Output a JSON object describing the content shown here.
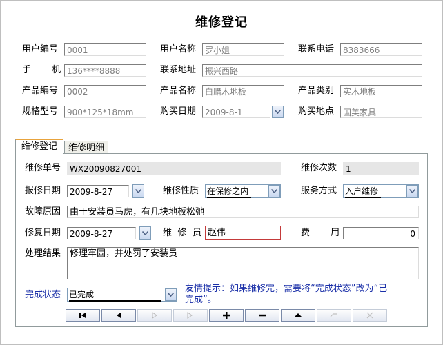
{
  "title": "维修登记",
  "top": {
    "user_id_label": "用户编号",
    "user_id": "0001",
    "user_name_label": "用户名称",
    "user_name": "罗小姐",
    "phone_label": "联系电话",
    "phone": "8383666",
    "mobile_label": "手机",
    "mobile": "136****8888",
    "address_label": "联系地址",
    "address": "振兴西路",
    "product_id_label": "产品编号",
    "product_id": "0002",
    "product_name_label": "产品名称",
    "product_name": "白腊木地板",
    "product_type_label": "产品类别",
    "product_type": "实木地板",
    "spec_label": "规格型号",
    "spec": "900*125*18mm",
    "buy_date_label": "购买日期",
    "buy_date": "2009-8-1",
    "buy_place_label": "购买地点",
    "buy_place": "国美家具"
  },
  "tabs": [
    "维修登记",
    "维修明细"
  ],
  "form": {
    "repair_no_label": "维修单号",
    "repair_no": "WX20090827001",
    "repair_count_label": "维修次数",
    "repair_count": "1",
    "report_date_label": "报修日期",
    "report_date": "2009-8-27",
    "repair_type_label": "维修性质",
    "repair_type": "在保修之内",
    "service_label": "服务方式",
    "service": "入户维修",
    "fault_label": "故障原因",
    "fault": "由于安装员马虎，有几块地板松弛",
    "fix_date_label": "修复日期",
    "fix_date": "2009-8-27",
    "repairer_label": "维修员",
    "repairer": "赵伟",
    "fee_label": "费用",
    "fee": "0",
    "result_label": "处理结果",
    "result": "修理牢固，并处罚了安装员",
    "status_label": "完成状态",
    "status": "已完成",
    "hint": "友情提示：如果维修完，需要将“完成状态”改为“已完成”。"
  },
  "nav_icons": [
    "first-record-icon",
    "prev-record-icon",
    "next-record-icon",
    "last-record-icon",
    "add-icon",
    "delete-icon",
    "save-icon",
    "undo-icon",
    "close-icon"
  ],
  "colors": {
    "hint": "#1a2fa8",
    "accent_tab": "#e8a33d",
    "required_border": "#c43a3a"
  }
}
